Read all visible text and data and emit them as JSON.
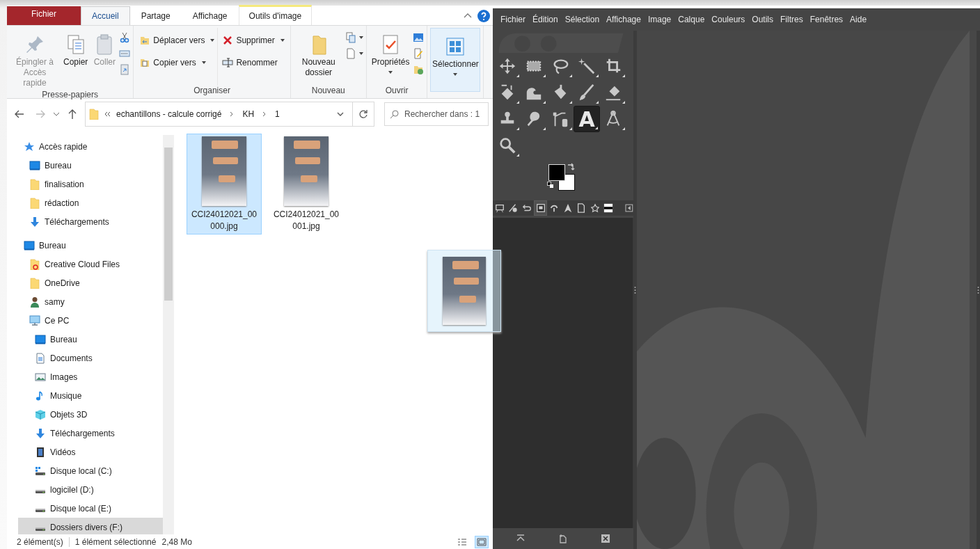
{
  "explorer": {
    "ribbon_tabs": [
      {
        "label": "Fichier",
        "kind": "file",
        "selected": false
      },
      {
        "label": "Accueil",
        "kind": "normal",
        "selected": true
      },
      {
        "label": "Partage",
        "kind": "normal",
        "selected": false
      },
      {
        "label": "Affichage",
        "kind": "normal",
        "selected": false
      },
      {
        "label": "Outils d'image",
        "kind": "contextual",
        "selected": false
      }
    ],
    "ribbon_groups": [
      {
        "label": "Presse-papiers",
        "commands": [
          {
            "kind": "large",
            "label": "Épingler à Accès rapide",
            "disabled": true,
            "dropdown": false
          },
          {
            "kind": "large",
            "label": "Copier",
            "disabled": false,
            "dropdown": false
          },
          {
            "kind": "large",
            "label": "Coller",
            "disabled": true,
            "dropdown": false
          },
          {
            "kind": "stack"
          }
        ]
      },
      {
        "label": "Organiser",
        "commands": [
          {
            "kind": "column",
            "items": [
              {
                "label": "Déplacer vers",
                "dropdown": true
              },
              {
                "label": "Copier vers",
                "dropdown": true
              }
            ]
          },
          {
            "kind": "column",
            "items": [
              {
                "label": "Supprimer",
                "dropdown": true
              },
              {
                "label": "Renommer",
                "dropdown": false
              }
            ]
          }
        ]
      },
      {
        "label": "Nouveau",
        "commands": [
          {
            "kind": "large",
            "label": "Nouveau dossier",
            "disabled": false,
            "dropdown": false
          },
          {
            "kind": "stack"
          }
        ]
      },
      {
        "label": "Ouvrir",
        "commands": [
          {
            "kind": "large",
            "label": "Propriétés",
            "disabled": false,
            "dropdown": true
          },
          {
            "kind": "stack"
          }
        ]
      },
      {
        "commands": [
          {
            "kind": "large",
            "label": "Sélectionner",
            "disabled": false,
            "dropdown": true,
            "selected": true
          }
        ]
      }
    ],
    "breadcrumbs": [
      "echantillons - calcule corrigé",
      "KH",
      "1"
    ],
    "search": {
      "placeholder": "Rechercher dans : 1"
    },
    "nav": [
      {
        "label": "Accès rapide",
        "kind": "star",
        "selected": false,
        "children": [
          {
            "label": "Bureau",
            "kind": "desktop",
            "selected": false
          },
          {
            "label": "finalisation",
            "kind": "folder",
            "selected": false
          },
          {
            "label": "rédaction",
            "kind": "folder",
            "selected": false
          },
          {
            "label": "Téléchargements",
            "kind": "download",
            "selected": false
          }
        ]
      },
      {
        "label": "Bureau",
        "kind": "desktop",
        "selected": false,
        "children": [
          {
            "label": "Creative Cloud Files",
            "kind": "cloudfolder",
            "selected": false
          },
          {
            "label": "OneDrive",
            "kind": "folder",
            "selected": false
          },
          {
            "label": "samy",
            "kind": "user",
            "selected": false
          },
          {
            "label": "Ce PC",
            "kind": "pc",
            "selected": false,
            "children": [
              {
                "label": "Bureau",
                "kind": "desktop",
                "selected": false
              },
              {
                "label": "Documents",
                "kind": "document",
                "selected": false
              },
              {
                "label": "Images",
                "kind": "image",
                "selected": false
              },
              {
                "label": "Musique",
                "kind": "music",
                "selected": false
              },
              {
                "label": "Objets 3D",
                "kind": "cube",
                "selected": false
              },
              {
                "label": "Téléchargements",
                "kind": "download",
                "selected": false
              },
              {
                "label": "Vidéos",
                "kind": "video",
                "selected": false
              },
              {
                "label": "Disque local (C:)",
                "kind": "sysdrive",
                "selected": false
              },
              {
                "label": "logicilel (D:)",
                "kind": "drive",
                "selected": false
              },
              {
                "label": "Disque local (E:)",
                "kind": "drive",
                "selected": false
              },
              {
                "label": "Dossiers divers (F:)",
                "kind": "drive",
                "selected": true
              }
            ]
          }
        ]
      }
    ],
    "files": [
      {
        "name": "CCI24012021_00000.jpg",
        "selected": true
      },
      {
        "name": "CCI24012021_00001.jpg",
        "selected": false
      }
    ],
    "status": {
      "count": "2 élément(s)",
      "selection": "1 élément sélectionné",
      "size": "2,48 Mo"
    },
    "view_modes": [
      {
        "kind": "details",
        "selected": false
      },
      {
        "kind": "thumbs",
        "selected": true
      }
    ]
  },
  "gimp": {
    "menu": [
      "Fichier",
      "Édition",
      "Sélection",
      "Affichage",
      "Image",
      "Calque",
      "Couleurs",
      "Outils",
      "Filtres",
      "Fenêtres",
      "Aide"
    ],
    "tools": [
      {
        "kind": "move",
        "selected": false
      },
      {
        "kind": "rect",
        "selected": false
      },
      {
        "kind": "lasso",
        "selected": false
      },
      {
        "kind": "wand",
        "selected": false
      },
      {
        "kind": "crop",
        "selected": false
      },
      {
        "kind": "transform",
        "selected": false
      },
      {
        "kind": "warp",
        "selected": false
      },
      {
        "kind": "bucket",
        "selected": false
      },
      {
        "kind": "brush",
        "selected": false
      },
      {
        "kind": "eraser",
        "selected": false
      },
      {
        "kind": "clone",
        "selected": false
      },
      {
        "kind": "smudge",
        "selected": false
      },
      {
        "kind": "paths",
        "selected": false
      },
      {
        "kind": "text",
        "symbol": "A",
        "selected": true
      },
      {
        "kind": "measure",
        "selected": false
      },
      {
        "kind": "zoom",
        "selected": false
      }
    ],
    "dock_tabs": [
      {
        "kind": "options",
        "selected": false
      },
      {
        "kind": "devices",
        "selected": false
      },
      {
        "kind": "undo",
        "selected": false
      },
      {
        "kind": "images",
        "selected": true
      },
      {
        "kind": "brushes",
        "selected": false
      },
      {
        "kind": "patterns",
        "selected": false
      },
      {
        "kind": "docs",
        "selected": false
      },
      {
        "kind": "fonts",
        "selected": false
      },
      {
        "kind": "gradient",
        "selected": false
      }
    ]
  }
}
